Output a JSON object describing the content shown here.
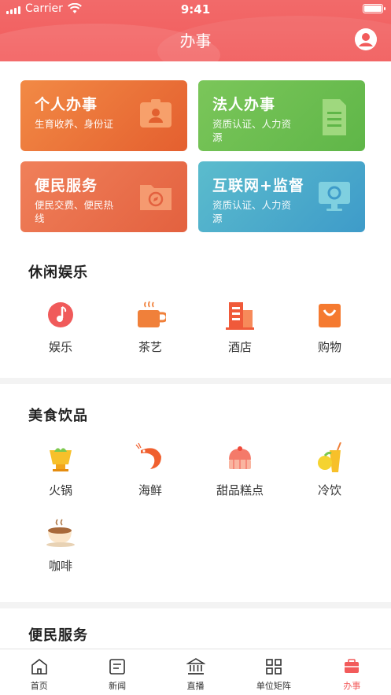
{
  "status_bar": {
    "carrier": "Carrier",
    "time": "9:41"
  },
  "header": {
    "title": "办事",
    "user_icon": "user-circle-icon"
  },
  "cards": [
    {
      "title": "个人办事",
      "subtitle": "生育收养、身份证",
      "icon": "id-card-icon",
      "color": "#e86a35"
    },
    {
      "title": "法人办事",
      "subtitle": "资质认证、人力资源",
      "icon": "document-icon",
      "color": "#6cbe52"
    },
    {
      "title": "便民服务",
      "subtitle": "便民交费、便民热线",
      "icon": "folder-compass-icon",
      "color": "#e96d48"
    },
    {
      "title": "互联网+监督",
      "subtitle": "资质认证、人力资源",
      "icon": "monitor-icon",
      "color": "#48a8cb"
    }
  ],
  "leisure": {
    "title": "休闲娱乐",
    "items": [
      {
        "label": "娱乐",
        "icon": "music-note-icon"
      },
      {
        "label": "茶艺",
        "icon": "tea-cup-icon"
      },
      {
        "label": "酒店",
        "icon": "hotel-building-icon"
      },
      {
        "label": "购物",
        "icon": "shopping-bag-icon"
      }
    ]
  },
  "food": {
    "title": "美食饮品",
    "items": [
      {
        "label": "火锅",
        "icon": "hotpot-icon"
      },
      {
        "label": "海鲜",
        "icon": "shrimp-icon"
      },
      {
        "label": "甜品糕点",
        "icon": "cake-icon"
      },
      {
        "label": "冷饮",
        "icon": "cold-drink-icon"
      },
      {
        "label": "咖啡",
        "icon": "coffee-icon"
      }
    ]
  },
  "convenience": {
    "title": "便民服务"
  },
  "tabbar": [
    {
      "label": "首页",
      "icon": "home-icon"
    },
    {
      "label": "新闻",
      "icon": "news-icon"
    },
    {
      "label": "直播",
      "icon": "government-building-icon"
    },
    {
      "label": "单位矩阵",
      "icon": "matrix-icon"
    },
    {
      "label": "办事",
      "icon": "affairs-icon",
      "active": true
    }
  ],
  "colors": {
    "accent": "#f25b5b",
    "background": "#f3f3f3"
  }
}
